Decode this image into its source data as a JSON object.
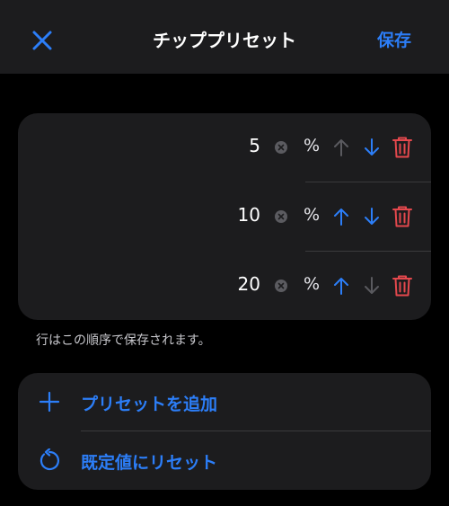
{
  "colors": {
    "accent": "#2c7ef8",
    "danger": "#e5484d",
    "disabled_arrow": "#5a5a5f"
  },
  "navbar": {
    "close_icon": "close-icon",
    "title": "チッププリセット",
    "save_label": "保存"
  },
  "presets": [
    {
      "value": "5",
      "unit": "%",
      "up_enabled": false,
      "down_enabled": true
    },
    {
      "value": "10",
      "unit": "%",
      "up_enabled": true,
      "down_enabled": true
    },
    {
      "value": "20",
      "unit": "%",
      "up_enabled": true,
      "down_enabled": false
    }
  ],
  "footnote": "行はこの順序で保存されます。",
  "actions": {
    "add_label": "プリセットを追加",
    "reset_label": "既定値にリセット"
  }
}
